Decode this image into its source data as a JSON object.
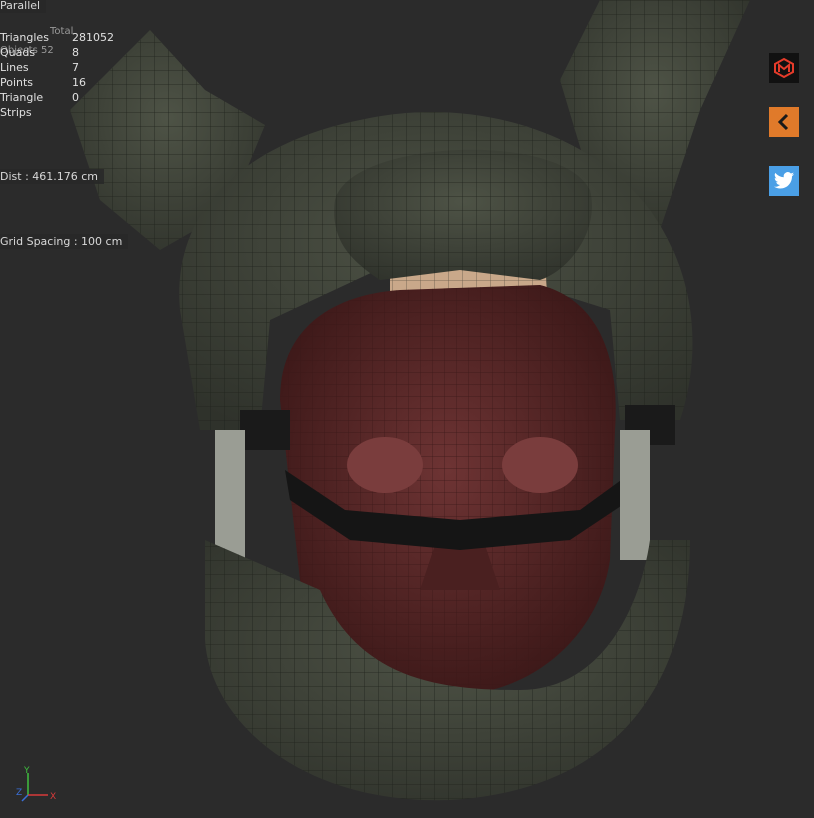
{
  "viewport": {
    "projection_label": "Parallel",
    "stats_header": "Total",
    "objects_overlay": "Objects   52",
    "stats": [
      {
        "label": "Triangles",
        "value": "281052"
      },
      {
        "label": "Quads",
        "value": "8"
      },
      {
        "label": "Lines",
        "value": "7"
      },
      {
        "label": "Points",
        "value": "16"
      },
      {
        "label": "Triangle Strips",
        "value": "0"
      }
    ],
    "dist": "Dist : 461.176 cm",
    "grid_spacing": "Grid Spacing : 100 cm"
  },
  "side_buttons": [
    {
      "name": "m-logo-button",
      "icon": "m-logo-icon"
    },
    {
      "name": "back-button",
      "icon": "chevron-left-icon"
    },
    {
      "name": "twitter-button",
      "icon": "twitter-bird-icon"
    }
  ],
  "axis": {
    "y": "Y",
    "x": "X",
    "z": "Z"
  },
  "colors": {
    "background": "#2b2b2b",
    "helmet": "#3f4339",
    "face": "#5a2a2a",
    "padding": "#c9a88a",
    "m_button": "#111111",
    "back_button": "#e07a2a",
    "twitter_button": "#4a9fe6"
  }
}
